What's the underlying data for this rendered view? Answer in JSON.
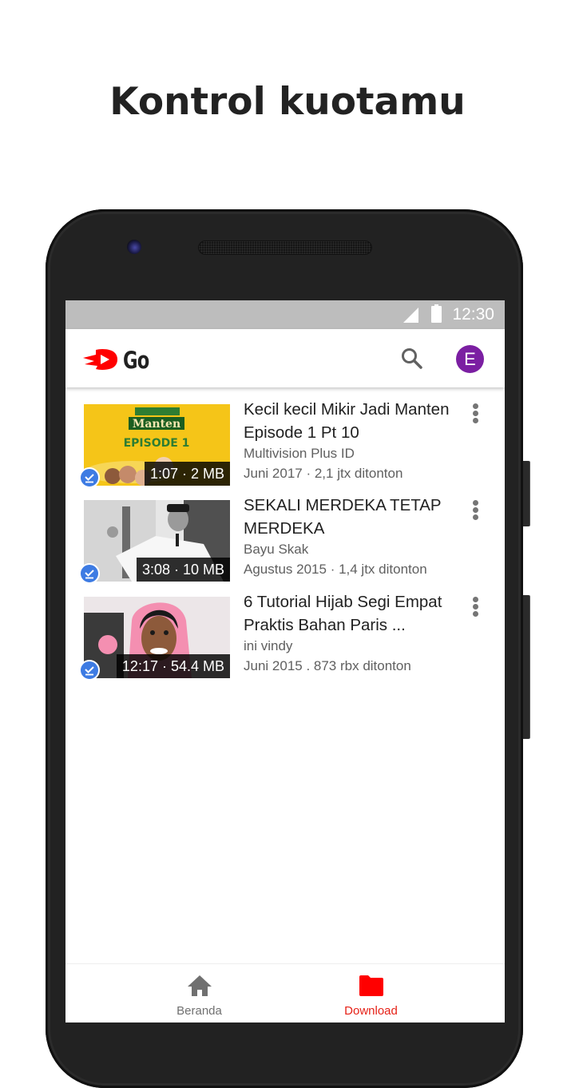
{
  "headline": "Kontrol kuotamu",
  "status_bar": {
    "time": "12:30",
    "icons": [
      "signal-icon",
      "battery-icon"
    ]
  },
  "app_bar": {
    "logo_text": "Go",
    "search_icon": "search-icon",
    "avatar_letter": "E",
    "avatar_color": "#7b1fa2"
  },
  "videos": [
    {
      "title": "Kecil kecil Mikir Jadi Manten Episode 1 Pt 10",
      "channel": "Multivision Plus ID",
      "stats": "Juni 2017 · 2,1 jtx ditonton",
      "duration_size": "1:07 · 2 MB",
      "thumb_text": "EPISODE 1",
      "downloaded": true
    },
    {
      "title": "SEKALI MERDEKA TETAP MERDEKA",
      "channel": "Bayu Skak",
      "stats": "Agustus 2015 · 1,4 jtx ditonton",
      "duration_size": "3:08 · 10 MB",
      "downloaded": true
    },
    {
      "title": "6 Tutorial Hijab Segi Empat Praktis Bahan Paris ...",
      "channel": "ini vindy",
      "stats": "Juni 2015 . 873 rbx ditonton",
      "duration_size": "12:17 · 54.4 MB",
      "downloaded": true
    }
  ],
  "bottom_nav": [
    {
      "label": "Beranda",
      "icon": "home-icon",
      "active": false
    },
    {
      "label": "Download",
      "icon": "folder-icon",
      "active": true
    }
  ],
  "colors": {
    "accent": "#ff0000",
    "active_nav_label": "#e62117",
    "inactive_nav": "#707070",
    "download_badge": "#3d7be3",
    "status_bar": "#bdbdbd"
  }
}
